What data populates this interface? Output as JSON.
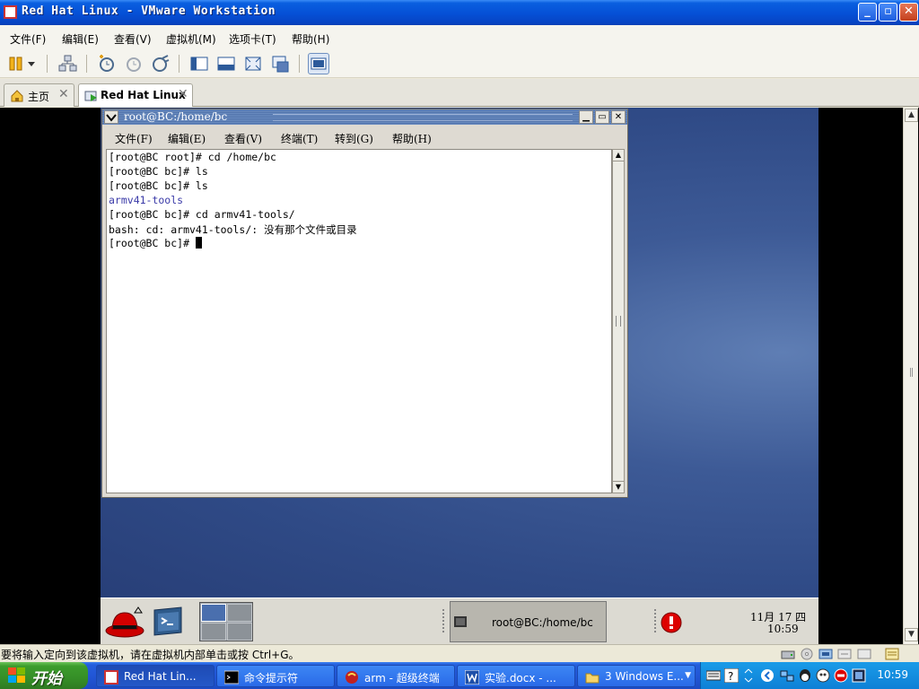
{
  "window": {
    "title": "Red Hat Linux - VMware Workstation",
    "controls": {
      "minimize": "_",
      "maximize": "▫",
      "close": "✕"
    }
  },
  "menubar": [
    "文件(F)",
    "编辑(E)",
    "查看(V)",
    "虚拟机(M)",
    "选项卡(T)",
    "帮助(H)"
  ],
  "toolbar": {
    "buttons": [
      "suspend-icon",
      "dropdown-arrow-icon",
      "network-icon",
      "snapshot-icon",
      "revert-snapshot-icon",
      "snapshot-manager-icon",
      "normal-view-icon",
      "quick-switch-icon",
      "full-screen-icon",
      "unity-icon",
      "console-view-icon"
    ]
  },
  "tabs": [
    {
      "label": "主页",
      "close": "✕",
      "active": false
    },
    {
      "label": "Red Hat Linux",
      "close": "✕",
      "active": true
    }
  ],
  "terminal": {
    "title": "root@BC:/home/bc",
    "menu": [
      "文件(F)",
      "编辑(E)",
      "查看(V)",
      "终端(T)",
      "转到(G)",
      "帮助(H)"
    ],
    "lines": [
      "[root@BC root]# cd /home/bc",
      "[root@BC bc]# ls",
      "[root@BC bc]# ls",
      "armv41-tools",
      "[root@BC bc]# cd armv41-tools/",
      "bash: cd: armv41-tools/: 没有那个文件或目录",
      "[root@BC bc]# "
    ]
  },
  "guest_panel": {
    "task_label": "root@BC:/home/bc",
    "date": "11月 17 四",
    "time": "10:59"
  },
  "statusbar": {
    "text": "要将输入定向到该虚拟机，请在虚拟机内部单击或按 Ctrl+G。"
  },
  "taskbar": {
    "start": "开始",
    "tasks": [
      {
        "label": "Red Hat Lin...",
        "active": true
      },
      {
        "label": "命令提示符",
        "active": false
      },
      {
        "label": "arm - 超级终端",
        "active": false
      },
      {
        "label": "实验.docx - ...",
        "active": false
      },
      {
        "label": "3 Windows E...",
        "active": false
      }
    ],
    "clock": "10:59"
  },
  "colors": {
    "xp_blue": "#245edc",
    "start_green": "#3c9c2c",
    "guest_desktop": "#3d5a96",
    "terminal_dir": "#3a3aa8"
  }
}
